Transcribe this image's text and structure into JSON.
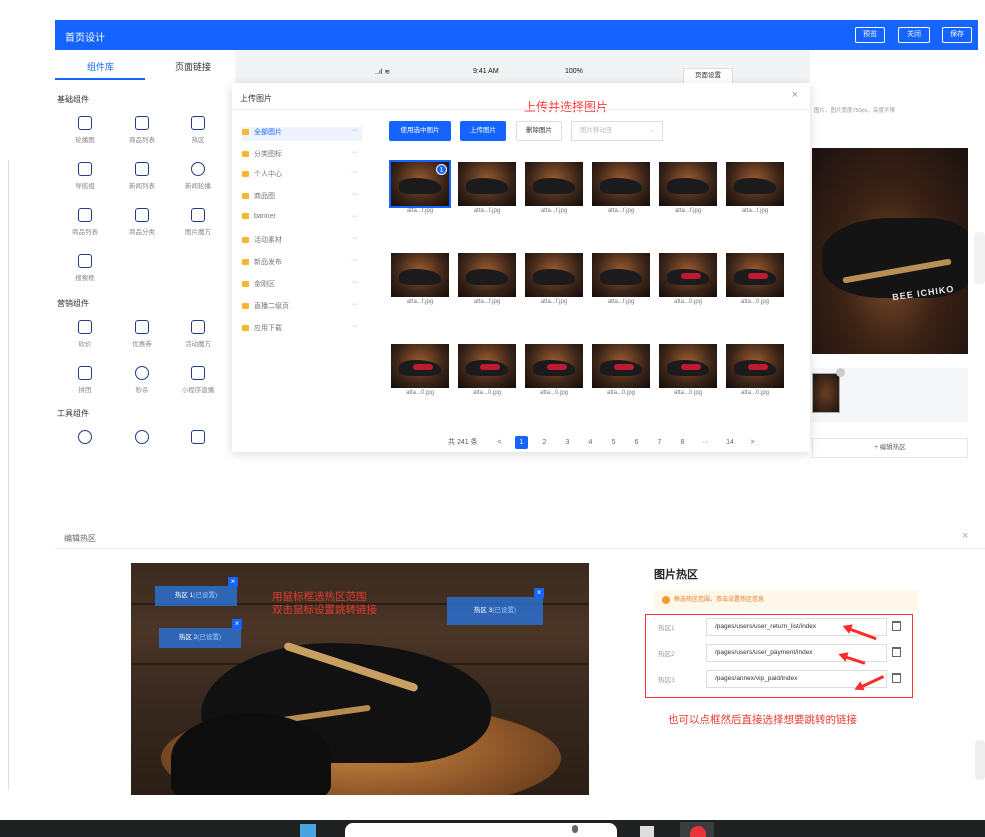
{
  "editor": {
    "title": "首页设计",
    "buttons": {
      "preview": "预览",
      "close": "关闭",
      "save": "保存"
    },
    "left_tabs": [
      "组件库",
      "页面链接"
    ],
    "sections": [
      {
        "title": "基础组件",
        "items": [
          {
            "label": "轮播图",
            "icon": "carousel-icon"
          },
          {
            "label": "商品列表",
            "icon": "product-list-icon"
          },
          {
            "label": "热区",
            "icon": "hotspot-icon"
          },
          {
            "label": "导航组",
            "icon": "nav-group-icon"
          },
          {
            "label": "新闻列表",
            "icon": "news-list-icon"
          },
          {
            "label": "新闻轮播",
            "icon": "news-carousel-icon"
          },
          {
            "label": "商品列表",
            "icon": "product-grid-icon"
          },
          {
            "label": "商品分类",
            "icon": "category-icon"
          },
          {
            "label": "图片魔方",
            "icon": "image-cube-icon"
          },
          {
            "label": "搜索框",
            "icon": "search-box-icon"
          }
        ]
      },
      {
        "title": "营销组件",
        "items": [
          {
            "label": "砍价",
            "icon": "bargain-icon"
          },
          {
            "label": "优惠券",
            "icon": "coupon-icon"
          },
          {
            "label": "活动魔方",
            "icon": "activity-cube-icon"
          },
          {
            "label": "拼团",
            "icon": "group-buy-icon"
          },
          {
            "label": "秒杀",
            "icon": "flash-sale-icon"
          },
          {
            "label": "小程序直播",
            "icon": "live-icon"
          }
        ]
      },
      {
        "title": "工具组件",
        "items": [
          {
            "label": "",
            "icon": "service-icon"
          },
          {
            "label": "",
            "icon": "tool-icon"
          },
          {
            "label": "",
            "icon": "square-icon"
          }
        ]
      }
    ],
    "phone": {
      "signal": "..ıl ≋",
      "time": "9:41 AM",
      "battery": "100%"
    },
    "page_setting": "页面设置",
    "right_hint": "图片，图片宽度750px，高度不限",
    "image_brand": "BEE ICHIKO",
    "edit_hotzone": "+ 编辑热区"
  },
  "upload_modal": {
    "title": "上传图片",
    "close": "×",
    "annotation": "上传并选择图片",
    "folders": [
      {
        "name": "全部图片",
        "active": true
      },
      {
        "name": "分类图标",
        "active": false
      },
      {
        "name": "个人中心",
        "active": false
      },
      {
        "name": "商品图",
        "active": false
      },
      {
        "name": "banner",
        "active": false
      },
      {
        "name": "活动素材",
        "active": false
      },
      {
        "name": "新品发布",
        "active": false
      },
      {
        "name": "金刚区",
        "active": false
      },
      {
        "name": "直播二级页",
        "active": false
      },
      {
        "name": "应用下载",
        "active": false
      }
    ],
    "folder_more": "···",
    "actions": {
      "use_selected": "使用选中图片",
      "upload": "上传图片",
      "delete": "删除图片",
      "move_placeholder": "图片移动至",
      "move_chevron": "⌵"
    },
    "selected_badge": "1",
    "images": [
      {
        "name": "atta...f.jpg",
        "red": false
      },
      {
        "name": "atta...f.jpg",
        "red": false
      },
      {
        "name": "atta...f.jpg",
        "red": false
      },
      {
        "name": "atta...f.jpg",
        "red": false
      },
      {
        "name": "atta...f.jpg",
        "red": false
      },
      {
        "name": "atta...f.jpg",
        "red": false
      },
      {
        "name": "atta...f.jpg",
        "red": false
      },
      {
        "name": "atta...f.jpg",
        "red": false
      },
      {
        "name": "atta...f.jpg",
        "red": false
      },
      {
        "name": "atta...f.jpg",
        "red": false
      },
      {
        "name": "atta...0.jpg",
        "red": true
      },
      {
        "name": "atta...0.jpg",
        "red": true
      },
      {
        "name": "atta...0.jpg",
        "red": true
      },
      {
        "name": "atta...0.jpg",
        "red": true
      },
      {
        "name": "atta...0.jpg",
        "red": true
      },
      {
        "name": "atta...0.jpg",
        "red": true
      },
      {
        "name": "atta...0.jpg",
        "red": true
      },
      {
        "name": "atta...0.jpg",
        "red": true
      }
    ],
    "pagination": {
      "total": "共 241 条",
      "prev": "<",
      "next": ">",
      "pages": [
        "1",
        "2",
        "3",
        "4",
        "5",
        "6",
        "7",
        "8",
        "···",
        "14"
      ],
      "current": "1"
    }
  },
  "hotzone_editor": {
    "title": "编辑热区",
    "close": "×",
    "zones": [
      {
        "label": "热区 1",
        "link": "(已设置)",
        "close": "×"
      },
      {
        "label": "热区 2",
        "link": "(已设置)",
        "close": "×"
      },
      {
        "label": "热区 3",
        "link": "(已设置)",
        "close": "×"
      }
    ],
    "annotation_line1": "用鼠标框选热区范围",
    "annotation_line2": "双击鼠标设置跳转链接",
    "panel_title": "图片热区",
    "tip": "框选热区范围，双击设置热区信息",
    "rows": [
      {
        "label": "热区1",
        "value": "/pages/users/user_return_list/index"
      },
      {
        "label": "热区2",
        "value": "/pages/users/user_payment/index"
      },
      {
        "label": "热区3",
        "value": "/pages/annex/vip_paid/index"
      }
    ],
    "annotation_bottom": "也可以点框然后直接选择想要跳转的链接"
  },
  "colors": {
    "primary": "#1664ff",
    "annotation": "#ff3b3b",
    "tip": "#e57c2a"
  }
}
